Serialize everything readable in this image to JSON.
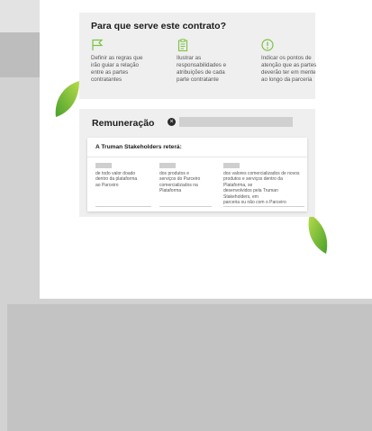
{
  "section_purpose": {
    "title": "Para que serve este contrato?",
    "columns": [
      {
        "icon": "flag-icon",
        "text": "Definir as regras que\nirão guiar a relação\nentre as partes\ncontratantes"
      },
      {
        "icon": "clipboard-icon",
        "text": "Ilustrar as\nresponsabilidades e\natribuições de cada\nparte contratante"
      },
      {
        "icon": "alert-circle-icon",
        "text": "Indicar os pontos de\natenção que as partes\ndeverão ter em mente\nao longo da parceria"
      }
    ]
  },
  "section_remuneration": {
    "title": "Remuneração",
    "close_glyph": "×",
    "inner_title": "A Truman Stakeholders reterá:",
    "columns": [
      {
        "text": "de todo valor doado\ndentro da plataforma\nao Parceiro"
      },
      {
        "text": "dos produtos e\nserviços do Parceiro\ncomercializados na\nPlataforma"
      },
      {
        "text": "dos valores comercializados de novos\nprodutos e serviços dentro da Plataforma, se\ndesenvolvidos pela Truman Stakeholders, em\nparceria ou não com o Parceiro"
      }
    ]
  },
  "colors": {
    "accent_green": "#7cc242",
    "leaf_dark": "#4aa02c",
    "leaf_light": "#b6dc4a"
  }
}
